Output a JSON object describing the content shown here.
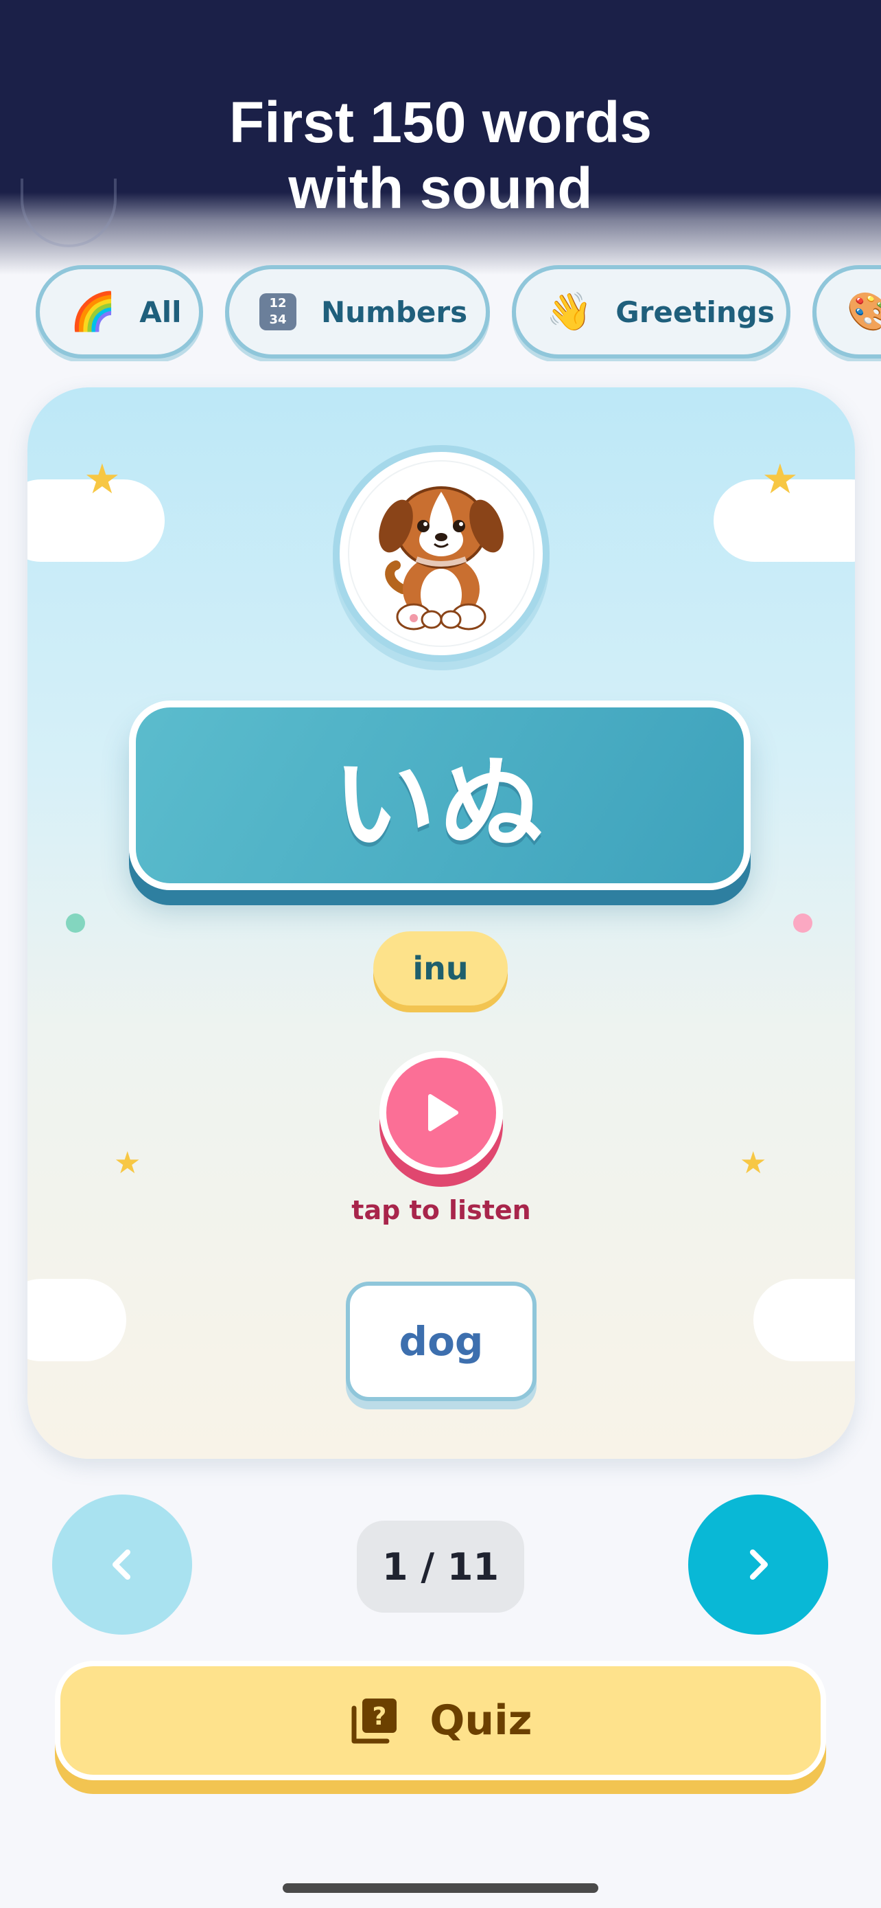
{
  "header": {
    "title": "First 150 words\nwith sound"
  },
  "categories": [
    {
      "label": "All",
      "icon": "rainbow-icon",
      "glyph": "🌈"
    },
    {
      "label": "Numbers",
      "icon": "numbers-keycap-icon",
      "glyph": "1234"
    },
    {
      "label": "Greetings",
      "icon": "waving-hand-icon",
      "glyph": "👋"
    },
    {
      "label": "",
      "icon": "palette-icon",
      "glyph": "🎨"
    }
  ],
  "card": {
    "image": "puppy-illustration",
    "word": "いぬ",
    "romaji": "inu",
    "listen_label": "tap to listen",
    "meaning": "dog"
  },
  "navigation": {
    "counter": "1 / 11",
    "prev_icon": "chevron-left-icon",
    "next_icon": "chevron-right-icon"
  },
  "quiz": {
    "label": "Quiz",
    "icon": "quiz-cards-icon"
  },
  "colors": {
    "header_bg": "#1b2048",
    "accent_blue": "#09b8d6",
    "word_box": "#3ea2bc",
    "play_pink": "#fb6f96",
    "quiz_yellow": "#fee28c"
  }
}
